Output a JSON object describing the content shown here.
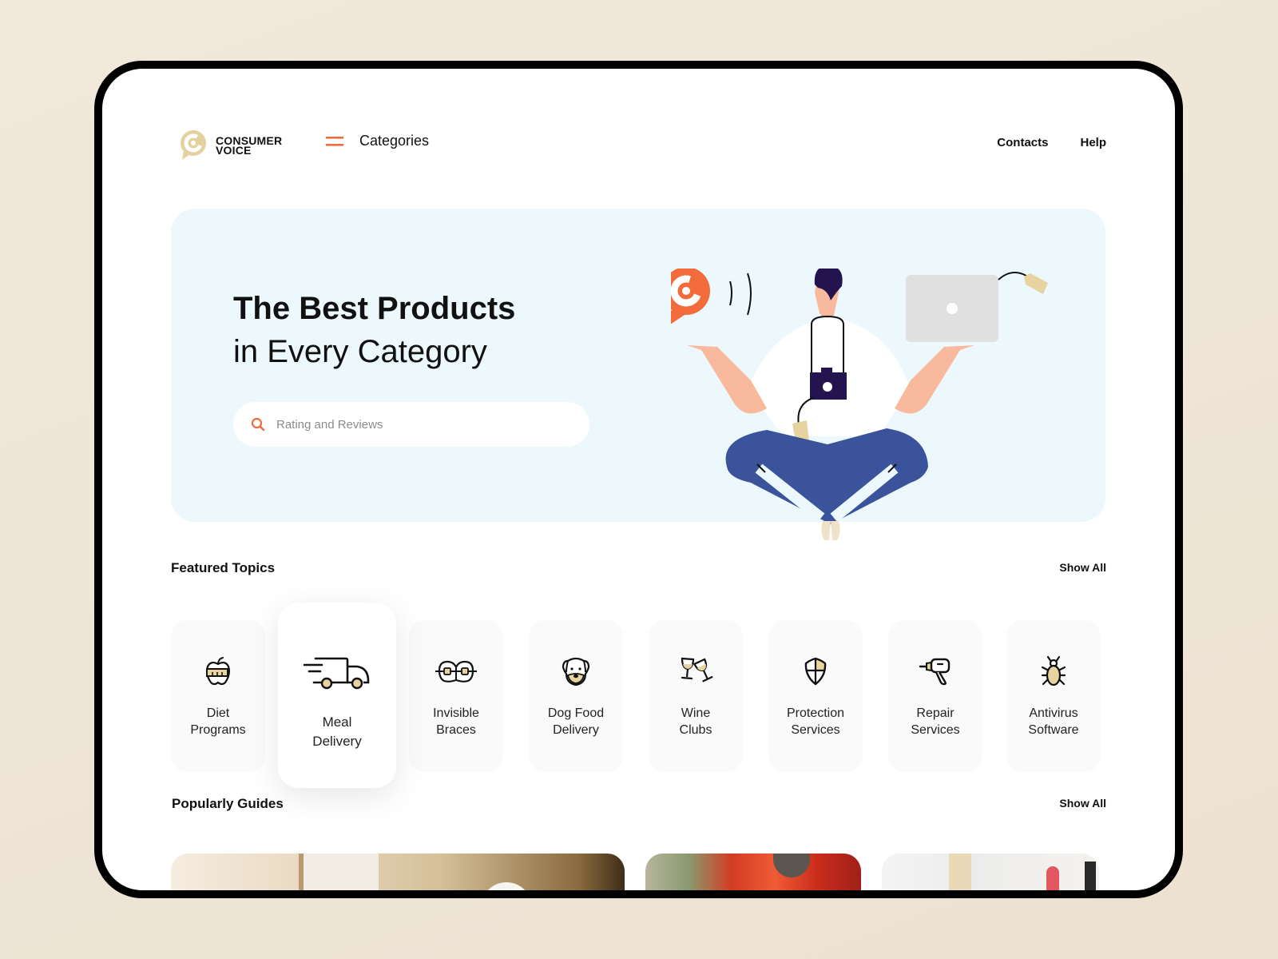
{
  "brand": {
    "line1": "CONSUMER",
    "line2": "VOICE",
    "color": "#e3d2a0"
  },
  "header": {
    "categories_label": "Categories",
    "nav": [
      "Contacts",
      "Help"
    ],
    "accent": "#f26b3a"
  },
  "hero": {
    "title_bold": "The Best Products",
    "title_light": "in Every Category",
    "search_placeholder": "Rating and Reviews",
    "background": "#edf8fd"
  },
  "featured": {
    "title": "Featured Topics",
    "show_all": "Show All",
    "items": [
      {
        "label": "Diet\nPrograms",
        "icon": "apple-measuring-tape-icon"
      },
      {
        "label": "Meal\nDelivery",
        "icon": "delivery-truck-icon",
        "active": true
      },
      {
        "label": "Invisible\nBraces",
        "icon": "braces-icon"
      },
      {
        "label": "Dog Food\nDelivery",
        "icon": "dog-face-icon"
      },
      {
        "label": "Wine\nClubs",
        "icon": "wine-glasses-icon"
      },
      {
        "label": "Protection\nServices",
        "icon": "shield-icon"
      },
      {
        "label": "Repair\nServices",
        "icon": "drill-icon"
      },
      {
        "label": "Antivirus\nSoftware",
        "icon": "bug-icon"
      }
    ]
  },
  "guides": {
    "title": "Popularly Guides",
    "show_all": "Show All",
    "items": [
      {
        "image": "home-interior-photo"
      },
      {
        "image": "cookware-pot-photo"
      },
      {
        "image": "cosmetics-photo"
      }
    ]
  }
}
